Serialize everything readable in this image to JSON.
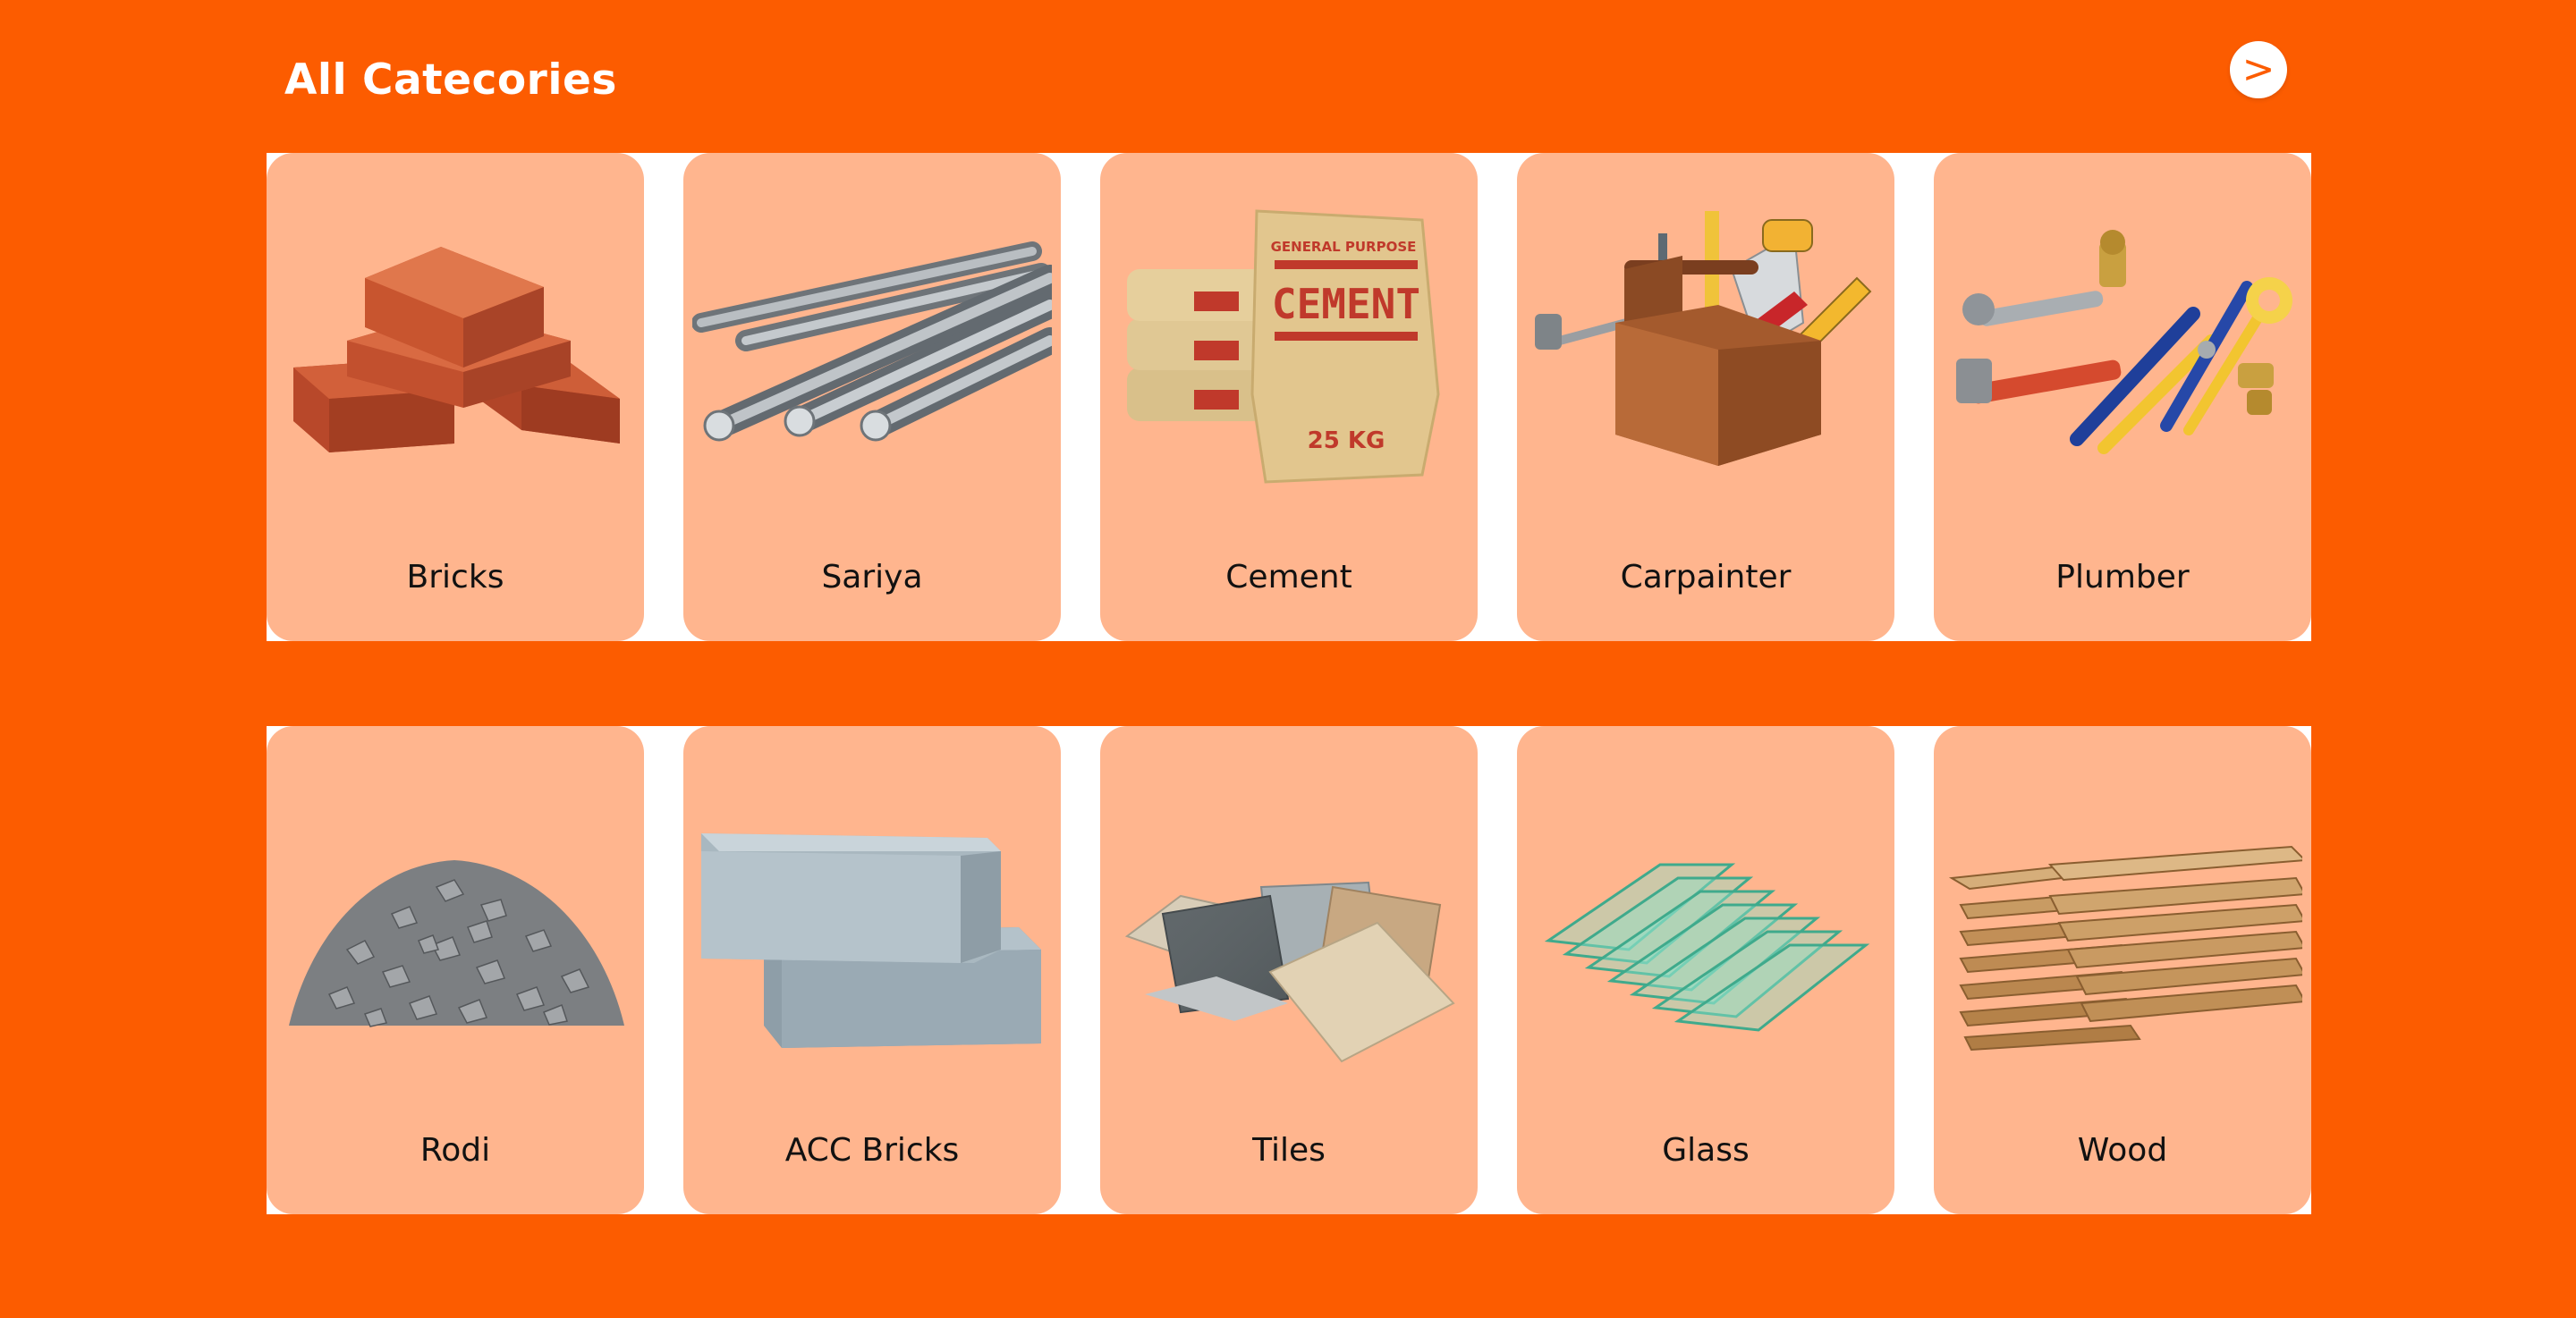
{
  "header": {
    "title": "All Catecories",
    "next_label": ">"
  },
  "theme": {
    "background": "#FC5C00",
    "card": "#FFB58E",
    "band": "#FFFFFF"
  },
  "categories": [
    {
      "label": "Bricks",
      "icon": "bricks-icon"
    },
    {
      "label": "Sariya",
      "icon": "steel-rebar-icon"
    },
    {
      "label": "Cement",
      "icon": "cement-bags-icon"
    },
    {
      "label": "Carpainter",
      "icon": "carpenter-toolbox-icon"
    },
    {
      "label": "Plumber",
      "icon": "plumbing-tools-icon"
    },
    {
      "label": "Rodi",
      "icon": "gravel-pile-icon"
    },
    {
      "label": "ACC Bricks",
      "icon": "acc-blocks-icon"
    },
    {
      "label": "Tiles",
      "icon": "tiles-icon"
    },
    {
      "label": "Glass",
      "icon": "glass-sheets-icon"
    },
    {
      "label": "Wood",
      "icon": "wood-planks-icon"
    }
  ],
  "cement_bag": {
    "line1": "GENERAL PURPOSE",
    "brand": "CEMENT",
    "weight": "25 KG"
  }
}
